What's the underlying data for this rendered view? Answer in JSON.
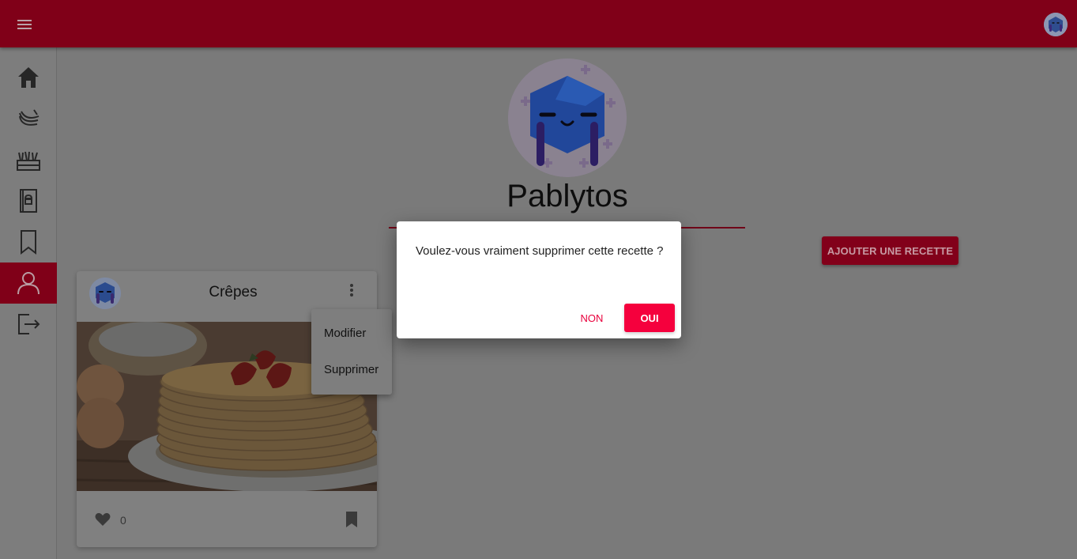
{
  "appbar": {
    "menu_icon": "hamburger-menu-icon",
    "user_avatar_icon": "robot-avatar-icon"
  },
  "sidebar": {
    "items": [
      {
        "id": "home",
        "icon": "home-icon",
        "active": false
      },
      {
        "id": "bananas",
        "icon": "banana-icon",
        "active": false
      },
      {
        "id": "vegetables",
        "icon": "vegetables-icon",
        "active": false
      },
      {
        "id": "recipe-book",
        "icon": "recipe-book-icon",
        "active": false
      },
      {
        "id": "bookmarks",
        "icon": "bookmark-icon",
        "active": false
      },
      {
        "id": "profile",
        "icon": "user-icon",
        "active": true
      },
      {
        "id": "logout",
        "icon": "logout-icon",
        "active": false
      }
    ]
  },
  "profile": {
    "username": "Pablytos",
    "avatar_icon": "robot-avatar-icon"
  },
  "actions": {
    "add_recipe_label": "AJOUTER UNE RECETTE"
  },
  "recipe_card": {
    "title": "Crêpes",
    "likes": "0",
    "image": "crepes-stack-with-strawberries",
    "icons": {
      "heart": "heart-icon",
      "bookmark": "bookmark-icon",
      "more": "more-vert-icon"
    }
  },
  "context_menu": {
    "items": [
      "Modifier",
      "Supprimer"
    ]
  },
  "dialog": {
    "message": "Voulez-vous vraiment supprimer cette recette ?",
    "cancel_label": "NON",
    "confirm_label": "OUI"
  },
  "colors": {
    "brand": "#800018",
    "accent": "#f5003d",
    "overlay": "#7a7a7a"
  }
}
